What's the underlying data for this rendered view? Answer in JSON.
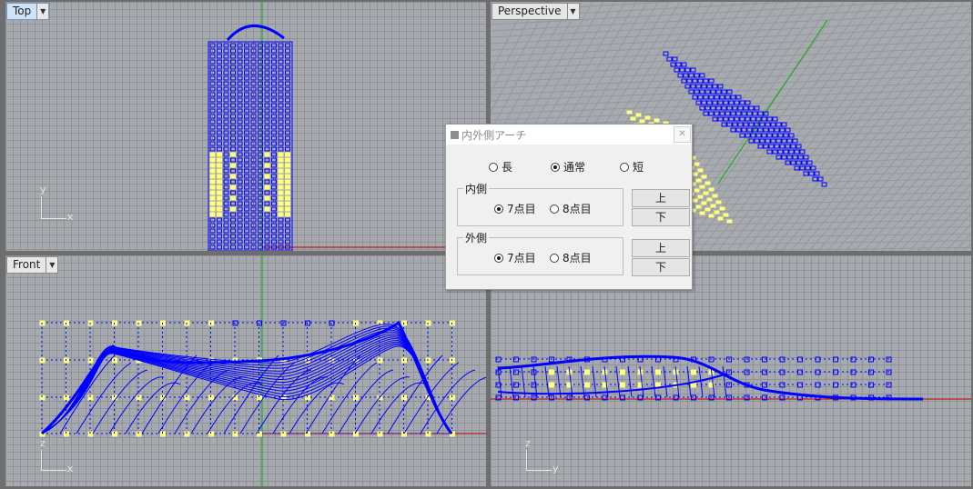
{
  "viewports": {
    "top": {
      "label": "Top",
      "active": true
    },
    "perspective": {
      "label": "Perspective",
      "active": false
    },
    "front": {
      "label": "Front",
      "active": false
    },
    "right": {
      "label": ""
    }
  },
  "axes": {
    "top": {
      "v": "y",
      "h": "x"
    },
    "front": {
      "v": "z",
      "h": "x"
    },
    "right": {
      "v": "z",
      "h": "y"
    }
  },
  "dialog": {
    "title": "内外側アーチ",
    "close_symbol": "✕",
    "arch": {
      "options": [
        "長",
        "通常",
        "短"
      ],
      "selected": "通常"
    },
    "inner": {
      "legend": "内側",
      "options": [
        "7点目",
        "8点目"
      ],
      "selected": "7点目",
      "up_label": "上",
      "down_label": "下"
    },
    "outer": {
      "legend": "外側",
      "options": [
        "7点目",
        "8点目"
      ],
      "selected": "7点目",
      "up_label": "上",
      "down_label": "下"
    }
  },
  "colors": {
    "viewport_bg": "#a6a9ae",
    "grid": "#8e9196",
    "curve_blue": "#0000ff",
    "point_yellow": "#ffff80",
    "axis_red": "#c00000",
    "axis_green": "#00b000"
  }
}
